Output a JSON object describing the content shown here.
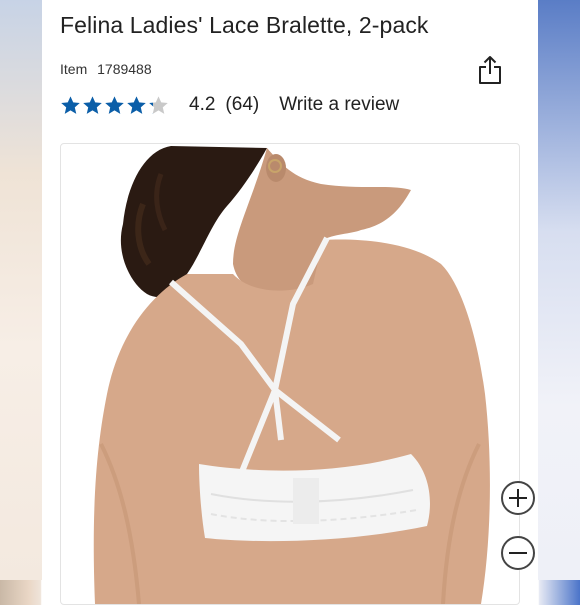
{
  "product": {
    "title": "Felina Ladies' Lace Bralette, 2-pack",
    "item_label": "Item",
    "item_number": "1789488"
  },
  "rating": {
    "value": "4.2",
    "count": "(64)",
    "stars_filled_fraction": 0.84,
    "write_review_label": "Write a review"
  },
  "icons": {
    "share": "share-icon",
    "star": "star-icon",
    "zoom_in": "plus-icon",
    "zoom_out": "minus-icon"
  },
  "colors": {
    "star": "#0b5ea8",
    "star_empty": "#c9c9c9",
    "text": "#222222"
  }
}
